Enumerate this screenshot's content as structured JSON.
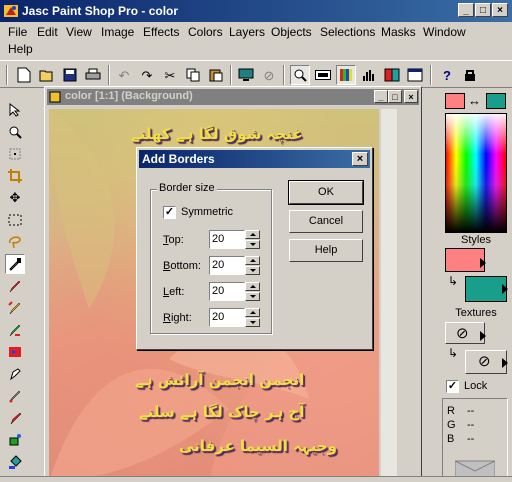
{
  "app": {
    "title": "Jasc Paint Shop Pro - color",
    "caption_buttons": [
      "_",
      "□",
      "×"
    ]
  },
  "menu": {
    "items": [
      "File",
      "Edit",
      "View",
      "Image",
      "Effects",
      "Colors",
      "Layers",
      "Objects",
      "Selections",
      "Masks",
      "Window",
      "Help"
    ]
  },
  "toolbar": {
    "icons": [
      "new-icon",
      "open-icon",
      "save-icon",
      "print-icon",
      "undo-icon",
      "redo-icon",
      "cut-icon",
      "copy-icon",
      "paste-icon",
      "full-screen-icon",
      "browse-icon",
      "zoom-icon",
      "toggle-toolbar-icon",
      "color-palette-icon",
      "histogram-icon",
      "layer-palette-icon",
      "overview-icon",
      "help-icon",
      "learning-center-icon"
    ]
  },
  "tools": {
    "icons": [
      "arrow-icon",
      "zoom-tool-icon",
      "deform-icon",
      "crop-icon",
      "mover-icon",
      "selection-icon",
      "freehand-icon",
      "dropper-icon",
      "paintbrush-icon",
      "clone-icon",
      "color-replacer-icon",
      "retouch-icon",
      "scratch-remover-icon",
      "eraser-icon",
      "picture-tube-icon",
      "airbrush-icon",
      "flood-fill-icon"
    ]
  },
  "document": {
    "title": "color [1:1] (Background)",
    "urdu_lines": [
      "غنچہ شوق لگا ہے کھلنے",
      "انجمن انجمن آرائش ہے",
      "آج ہر چاک لگا ہے سلنے",
      "وجیہہ السیما عرفانی"
    ]
  },
  "palette": {
    "styles_label": "Styles",
    "textures_label": "Textures",
    "lock_label": "Lock",
    "lock_checked": true,
    "foreground_color": "#ff8080",
    "background_color": "#1a9e8c",
    "rgb": [
      {
        "label": "R",
        "value": "--"
      },
      {
        "label": "G",
        "value": "--"
      },
      {
        "label": "B",
        "value": "--"
      }
    ]
  },
  "dialog": {
    "title": "Add Borders",
    "group_label": "Border size",
    "symmetric_label": "Symmetric",
    "symmetric_checked": true,
    "fields": [
      {
        "label_pre": "",
        "label_accel": "T",
        "label_post": "op:",
        "value": "20"
      },
      {
        "label_pre": "",
        "label_accel": "B",
        "label_post": "ottom:",
        "value": "20"
      },
      {
        "label_pre": "",
        "label_accel": "L",
        "label_post": "eft:",
        "value": "20"
      },
      {
        "label_pre": "",
        "label_accel": "R",
        "label_post": "ight:",
        "value": "20"
      }
    ],
    "buttons": {
      "ok": "OK",
      "cancel": "Cancel",
      "help": "Help"
    }
  },
  "colors": {
    "title_active": "#0a246a",
    "title_inactive": "#808080",
    "face": "#d4d0c8"
  }
}
